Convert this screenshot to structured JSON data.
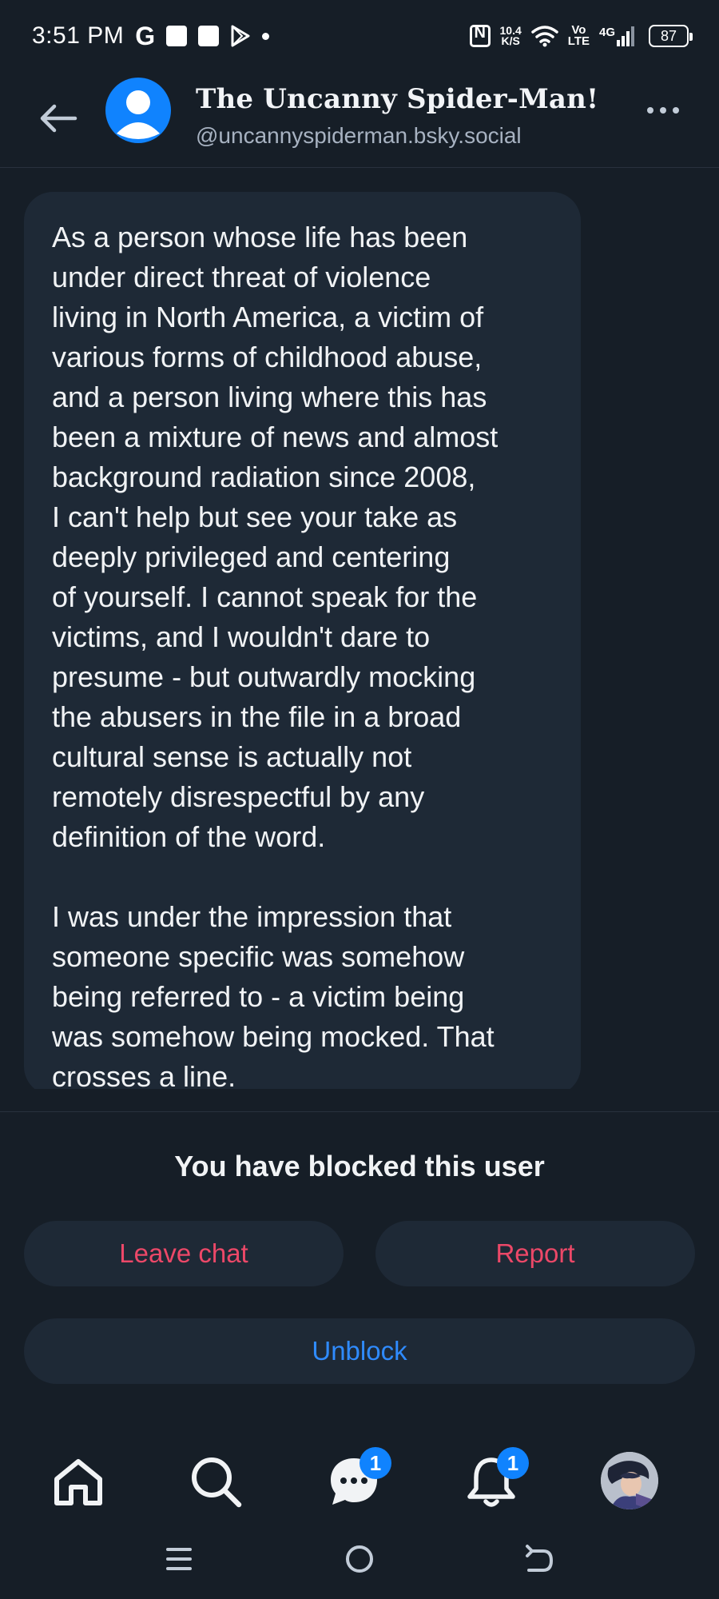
{
  "status_bar": {
    "time": "3:51 PM",
    "g_label": "G",
    "net_speed_value": "10.4",
    "net_speed_unit": "K/S",
    "volte_top": "Vo",
    "volte_bottom": "LTE",
    "network": "4G",
    "battery": "87"
  },
  "header": {
    "title": "The Uncanny Spider-Man!",
    "handle": "@uncannyspiderman.bsky.social"
  },
  "message": {
    "paragraph_1": "As a person whose life has been\nunder direct threat of violence\nliving in North America, a victim of\nvarious forms of childhood abuse,\nand a person living where this has\nbeen a mixture of news and almost\nbackground radiation since 2008,\nI can't help but see your take as\ndeeply privileged and centering\nof yourself. I cannot speak for the\nvictims, and I wouldn't dare to\npresume - but outwardly mocking\nthe abusers in the file in a broad\ncultural sense is actually not\nremotely disrespectful by any\ndefinition of the word.",
    "paragraph_2": "I was under the impression that\nsomeone specific was somehow\nbeing referred to - a victim being\nwas somehow being mocked. That\ncrosses a line."
  },
  "blocked": {
    "notice": "You have blocked this user",
    "leave_label": "Leave chat",
    "report_label": "Report",
    "unblock_label": "Unblock"
  },
  "bottom_nav": {
    "chat_badge": "1",
    "notifications_badge": "1"
  },
  "colors": {
    "background": "#161e27",
    "bubble": "#1e2936",
    "accent_blue": "#1083fe",
    "danger": "#ec4868"
  }
}
